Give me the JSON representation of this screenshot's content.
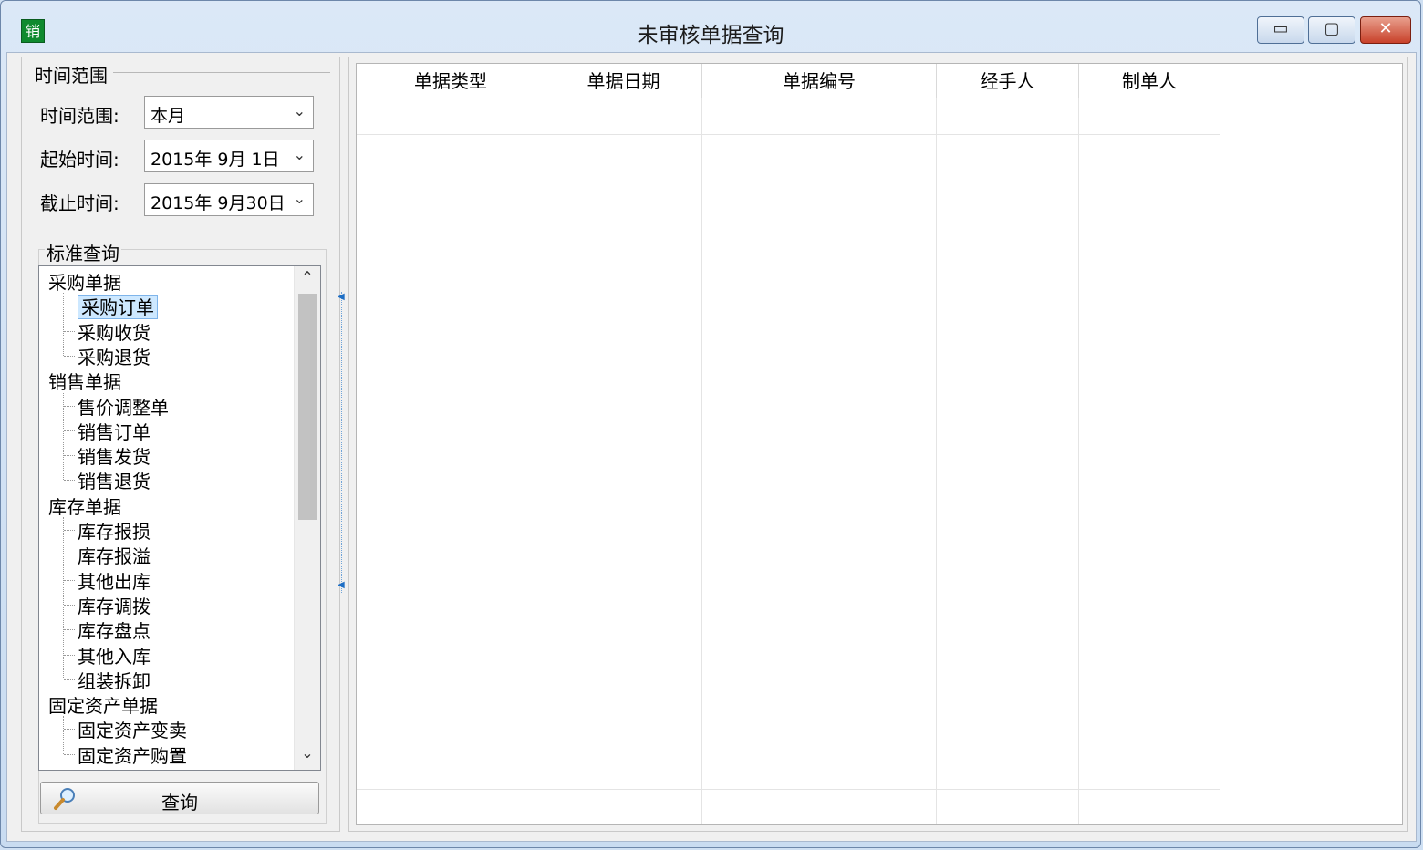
{
  "window": {
    "title": "未审核单据查询",
    "app_icon_text": "销",
    "controls": {
      "minimize": "▭",
      "maximize": "▢",
      "close": "✕"
    }
  },
  "time_range": {
    "group_title": "时间范围",
    "range_label": "时间范围:",
    "range_value": "本月",
    "start_label": "起始时间:",
    "start_value": "2015年  9月  1日",
    "end_label": "截止时间:",
    "end_value": "2015年  9月30日"
  },
  "standard_query": {
    "group_title": "标准查询",
    "tree": [
      {
        "label": "采购单据",
        "children": [
          "采购订单",
          "采购收货",
          "采购退货"
        ]
      },
      {
        "label": "销售单据",
        "children": [
          "售价调整单",
          "销售订单",
          "销售发货",
          "销售退货"
        ]
      },
      {
        "label": "库存单据",
        "children": [
          "库存报损",
          "库存报溢",
          "其他出库",
          "库存调拨",
          "库存盘点",
          "其他入库",
          "组装拆卸"
        ]
      },
      {
        "label": "固定资产单据",
        "children": [
          "固定资产变卖",
          "固定资产购置"
        ]
      }
    ],
    "selected_item": "采购订单",
    "query_button": "查询"
  },
  "grid": {
    "columns": [
      "单据类型",
      "单据日期",
      "单据编号",
      "经手人",
      "制单人"
    ],
    "rows": []
  }
}
